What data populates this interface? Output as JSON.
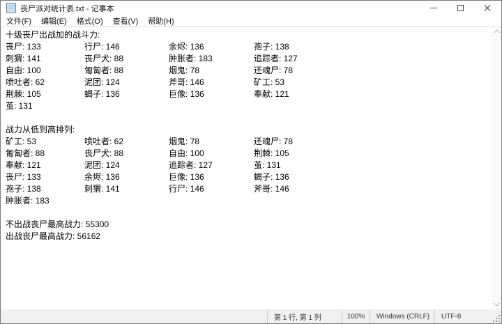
{
  "window": {
    "title": "丧尸派对统计表.txt - 记事本"
  },
  "menu": {
    "items": [
      {
        "id": "file",
        "label": "文件(F)"
      },
      {
        "id": "edit",
        "label": "编辑(E)"
      },
      {
        "id": "format",
        "label": "格式(O)"
      },
      {
        "id": "view",
        "label": "查看(V)"
      },
      {
        "id": "help",
        "label": "帮助(H)"
      }
    ]
  },
  "document": {
    "sections": [
      {
        "heading": "十级丧尸出战加的战斗力:",
        "rows": [
          [
            {
              "name": "丧尸",
              "value": 133
            },
            {
              "name": "行尸",
              "value": 146
            },
            {
              "name": "余烬",
              "value": 136
            },
            {
              "name": "孢子",
              "value": 138
            }
          ],
          [
            {
              "name": "刺猬",
              "value": 141
            },
            {
              "name": "丧尸犬",
              "value": 88
            },
            {
              "name": "肿胀者",
              "value": 183
            },
            {
              "name": "追踪者",
              "value": 127
            }
          ],
          [
            {
              "name": "自由",
              "value": 100
            },
            {
              "name": "匍匐者",
              "value": 88
            },
            {
              "name": "烟鬼",
              "value": 78
            },
            {
              "name": "还魂尸",
              "value": 78
            }
          ],
          [
            {
              "name": "喷吐者",
              "value": 62
            },
            {
              "name": "泥团",
              "value": 124
            },
            {
              "name": "斧哥",
              "value": 146
            },
            {
              "name": "矿工",
              "value": 53
            }
          ],
          [
            {
              "name": "荆棘",
              "value": 105
            },
            {
              "name": "蝎子",
              "value": 136
            },
            {
              "name": "巨像",
              "value": 136
            },
            {
              "name": "奉献",
              "value": 121
            }
          ],
          [
            {
              "name": "茧",
              "value": 131
            }
          ]
        ]
      },
      {
        "heading": "战力从低到高排列:",
        "rows": [
          [
            {
              "name": "矿工",
              "value": 53
            },
            {
              "name": "喷吐者",
              "value": 62
            },
            {
              "name": "烟鬼",
              "value": 78
            },
            {
              "name": "还魂尸",
              "value": 78
            }
          ],
          [
            {
              "name": "匍匐者",
              "value": 88
            },
            {
              "name": "丧尸犬",
              "value": 88
            },
            {
              "name": "自由",
              "value": 100
            },
            {
              "name": "荆棘",
              "value": 105
            }
          ],
          [
            {
              "name": "奉献",
              "value": 121
            },
            {
              "name": "泥团",
              "value": 124
            },
            {
              "name": "追踪者",
              "value": 127
            },
            {
              "name": "茧",
              "value": 131
            }
          ],
          [
            {
              "name": "丧尸",
              "value": 133
            },
            {
              "name": "余烬",
              "value": 136
            },
            {
              "name": "巨像",
              "value": 136
            },
            {
              "name": "蝎子",
              "value": 136
            }
          ],
          [
            {
              "name": "孢子",
              "value": 138
            },
            {
              "name": "刺猬",
              "value": 141
            },
            {
              "name": "行尸",
              "value": 146
            },
            {
              "name": "斧哥",
              "value": 146
            }
          ],
          [
            {
              "name": "肿胀者",
              "value": 183
            }
          ]
        ]
      }
    ],
    "summary": [
      {
        "label": "不出战丧尸最高战力",
        "value": "55300"
      },
      {
        "label": "出战丧尸最高战力",
        "value": "56162"
      }
    ]
  },
  "status": {
    "line_col": "第 1 行, 第 1 列",
    "zoom": "100%",
    "eol": "Windows (CRLF)",
    "encoding": "UTF-8"
  },
  "colors": {
    "window_border": "#7a7a7a",
    "titlebar_bg": "#ffffff",
    "statusbar_bg": "#f0f0f0"
  }
}
